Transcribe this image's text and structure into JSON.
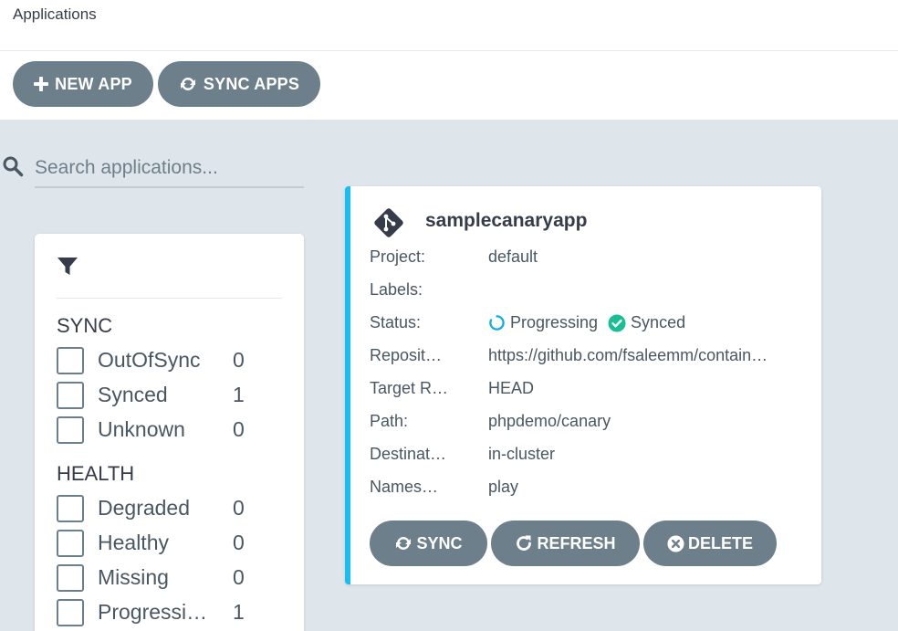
{
  "header": {
    "title": "Applications"
  },
  "toolbar": {
    "new_app_label": "NEW APP",
    "sync_apps_label": "SYNC APPS"
  },
  "search": {
    "placeholder": "Search applications..."
  },
  "filters": {
    "sync_heading": "SYNC",
    "sync_items": [
      {
        "label": "OutOfSync",
        "count": "0"
      },
      {
        "label": "Synced",
        "count": "1"
      },
      {
        "label": "Unknown",
        "count": "0"
      }
    ],
    "health_heading": "HEALTH",
    "health_items": [
      {
        "label": "Degraded",
        "count": "0"
      },
      {
        "label": "Healthy",
        "count": "0"
      },
      {
        "label": "Missing",
        "count": "0"
      },
      {
        "label": "Progressi…",
        "count": "1"
      }
    ]
  },
  "app": {
    "name": "samplecanaryapp",
    "fields": {
      "project_key": "Project:",
      "project_val": "default",
      "labels_key": "Labels:",
      "labels_val": "",
      "status_key": "Status:",
      "health_status": "Progressing",
      "sync_status": "Synced",
      "repo_key": "Reposit…",
      "repo_val": "https://github.com/fsaleemm/contain…",
      "target_key": "Target R…",
      "target_val": "HEAD",
      "path_key": "Path:",
      "path_val": "phpdemo/canary",
      "dest_key": "Destinat…",
      "dest_val": "in-cluster",
      "ns_key": "Names…",
      "ns_val": "play"
    },
    "actions": {
      "sync": "SYNC",
      "refresh": "REFRESH",
      "delete": "DELETE"
    }
  },
  "colors": {
    "accent": "#18bef2",
    "button": "#6d7f8b",
    "background": "#dee6eb",
    "progressing": "#0dadea",
    "synced": "#18be94"
  },
  "icons": [
    "plus-icon",
    "sync-icon",
    "search-icon",
    "filter-icon",
    "git-icon",
    "progressing-icon",
    "check-circle-icon",
    "refresh-icon",
    "times-circle-icon"
  ]
}
